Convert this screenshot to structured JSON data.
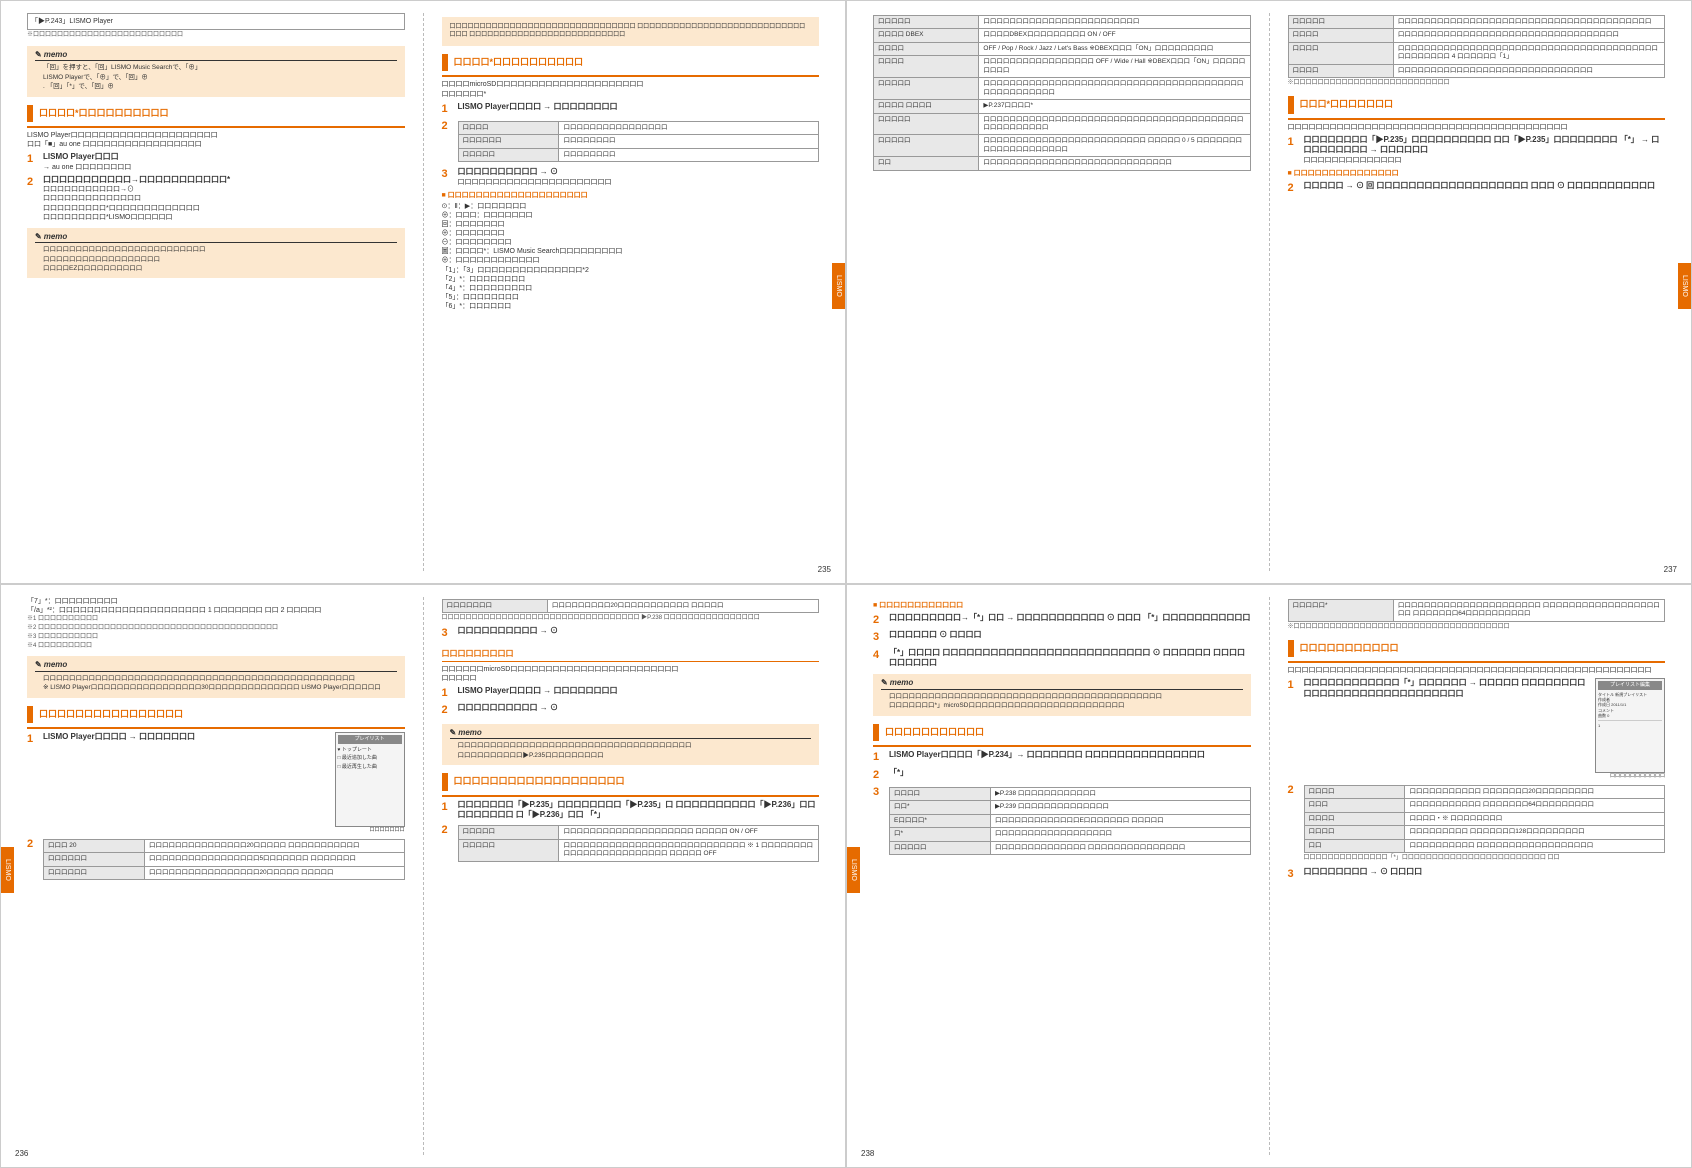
{
  "tab": "LISMO",
  "p235": {
    "num": "235",
    "c1": {
      "top": "「▶P.243」LISMO Player",
      "memo1": [
        "「回」を押すと、「回」LISMO Music Searchで、「⊕」",
        "LISMO Playerで、「⊕」で、「回」⊕",
        ". 「回」「*」で、「回」⊕"
      ],
      "sect1": "口口口口*口口口口口口口口口口",
      "body1": [
        "LISMO Player口口口口口口口口口口口口口口口口口口口口口",
        "口口「■」au one 口口口口口口口口口口口口口口口口口"
      ],
      "step1": {
        "t": "LISMO Player口口口",
        "s": "→ au one 口口口口口口口口"
      },
      "step2": "口口口口口口口口口口口→口口口口口口口口口口口*",
      "step2b": [
        "口口口口口口口口口口口→⊙",
        "口口口口口口口口口口口口口口",
        "口口口口口口口口口*口口口口口口口口口口口口口",
        "口口口口口口口口口*LISMO口口口口口口"
      ],
      "memo2": [
        "口口口口口口口口口口口口口口口口口口口口口口口口口",
        "口口口口口口口口口口口口口口口口口口",
        "口口口口EZ口口口口口口口口口口"
      ]
    },
    "c2": {
      "beige": "口口口口口口口口口口口口口口口口口口口口口口口口口口口口口口口\n口口口口口口口口口口口口口口口口口口口口口口口口口口口口口口口\n口口口口口口口口口口口口口口口口口口口口口口口口口口",
      "sect": "口口口口*口口口口口口口口口口",
      "body": [
        "口口口口microSD口口口口口口口口口口口口口口口口口口口口口",
        "口口口口口口*"
      ],
      "step1": "LISMO Player口口口口 → 口口口口口口口口",
      "step2tbl": [
        [
          "口口口口",
          "口口口口口口口口口口口口口口口口"
        ],
        [
          "口口口口口口",
          "口口口口口口口口"
        ],
        [
          "口口口口口",
          "口口口口口口口口"
        ]
      ],
      "step3": "口口口口口口口口口口 → ⊙",
      "sub": "■ 口口口口口口口口口口口口口口口口口口口口",
      "keys": [
        "⊙：Ⅱ：▶：口口口口口口口",
        "⊕：口口口：口口口口口口口",
        "回：口口口口口口口",
        "⊕：口口口口口口口",
        "⊖：口口口口口口口口",
        "圖：口口口口*：LISMO Music Search口口口口口口口口口",
        "⊕：口口口口口口口口口口口口",
        "「1」：「3」口口口口口口口口口口口口口口口*2",
        "「2」*：口口口口口口口口",
        "「4」*：口口口口口口口口口",
        "「5」：口口口口口口口口",
        "「6」*：口口口口口口"
      ]
    }
  },
  "p237": {
    "num": "237",
    "c1": {
      "tbl": [
        [
          "口口口口口",
          "口口口口口口口口口口口口口口口口口口口口口口口口"
        ],
        [
          "口口口口 DBEX",
          "口口口口DBEX口口口口口口口口口\nON / OFF"
        ],
        [
          "口口口口",
          "OFF / Pop / Rock / Jazz / Let's Bass\n※DBEX口口口「ON」口口口口口口口口口"
        ],
        [
          "口口口口",
          "口口口口口口口口口口口口口口口口口\nOFF / Wide / Hall\n※DBEX口口口「ON」口口口口口口口口口"
        ],
        [
          "口口口口口",
          "口口口口口口口口口口口口口口口口口口口口口口口口口口口口口口口口口口口口口口口口口口口口口口口口口口口"
        ],
        [
          "口口口口 口口口口",
          "▶P.237口口口口*"
        ],
        [
          "口口口口口",
          "口口口口口口口口口口口口口口口口口口口口口口口口口口口口口口口口口口口口口口口口口口口口口口口口口口"
        ],
        [
          "口口口口口",
          "口口口口口口口口口口口口口口口口口口口口口口口口口\n口口口口口 0 / 5 口口口口口口口口口口口口口口口口口口口口"
        ],
        [
          "口口",
          "口口口口口口口口口口口口口口口口口口口口口口口口口口口口口"
        ]
      ]
    },
    "c2": {
      "tbl": [
        [
          "口口口口口",
          "口口口口口口口口口口口口口口口口口口口口口口口口口口口口口口口口口口口口口口口"
        ],
        [
          "口口口口",
          "口口口口口口口口口口口口口口口口口口口口口口口口口口口口口口口口口口"
        ],
        [
          "口口口口",
          "口口口口口口口口口口口口口口口口口口口口口口口口口口口口口口口口口口口口口口口口口口口口口口口口 4 口口口口口口「1」"
        ],
        [
          "口口口口",
          "口口口口口口口口口口口口口口口口口口口口口口口口口口口口口口"
        ]
      ],
      "note": "※口口口口口口口口口口口口口口口口口口口口口口口口口口",
      "sect": "口口口*口口口口口口口",
      "body": "口口口口口口口口口口口口口口口口口口口口口口口口口口口口口口口口口口口口口口口口",
      "step1": "口口口口口口口口「▶P.235」口口口口口口口口口口 \n口口「▶P.235」口口口口口口口口  「*」\n→ 口口口口口口口口口 → 口口口口口口",
      "sub": "■ 口口口口口口口口口口口口口口口",
      "step2": "口口口口口 → ⊙\n回 口口口口口口口口口口口口口口口口口口口\n口口口 ⊙ 口口口口口口口口口口口"
    }
  },
  "p236": {
    "num": "236",
    "c1": {
      "keys": [
        "「7」*：口口口口口口口口口",
        "「/a」*²：口口口口口口口口口口口口口口口口口口口口口 1 口口口口口口口\n 口口 2 口口口口口"
      ],
      "notes": [
        "※1 口口口口口口口口口口",
        "※2 口口口口口口口口口口口口口口口口口口口口口口口口口口口口口口口口口口口口口口口口",
        "※3 口口口口口口口口口口",
        "※4 口口口口口口口口口"
      ],
      "memo": [
        "口口口口口口口口口口口口口口口口口口口口口口口口口口口口口口口口口口口口口口口口口口口口口口口口",
        "※ LISMO Player口口口口口口口口口口口口口口口口口30口口口口口口口口口口口口口口\n LISMO Player口口口口口口"
      ],
      "sect": "口口口口口口口口口口口口口口口口",
      "step1": "LISMO Player口口口口\n→ 口口口口口口口",
      "mock": {
        "title": "プレイリスト",
        "items": [
          "♥ トップレート",
          "□ 最近追加した曲",
          "□ 最近再生した曲"
        ],
        "cap": "口口口口口口口"
      },
      "step2tbl": [
        [
          "口口口 20",
          "口口口口口口口口口口口口口口口20口口口口口\n口口口口口口口口口口口"
        ],
        [
          "口口口口口口",
          "口口口口口口口口口口口口口口口口口5口口口口口口口\n口口口口口口口"
        ],
        [
          "口口口口口口",
          "口口口口口口口口口口口口口口口口口20口口口口口\n口口口口口"
        ]
      ]
    },
    "c2": {
      "tbl1": [
        [
          "口口口口口口口",
          "口口口口口口口口口20口口口口口口口口口口口\n口口口口口"
        ]
      ],
      "tbl1note": "口口口口口口口口口口口口口口口口口口口口口口口口口口口口口口口口口\n▶P.238 口口口口口口口口口口口口口口口口",
      "step3": "口口口口口口口口口口 → ⊙",
      "sect1": "口口口口口口口口口",
      "body1": [
        "口口口口口口microSD口口口口口口口口口口口口口口口口口口口口口口口口",
        "口口口口口"
      ],
      "step1": "LISMO Player口口口口 → 口口口口口口口口",
      "step2": "口口口口口口口口口口 → ⊙",
      "memo": [
        "口口口口口口口口口口口口口口口口口口口口口口口口口口口口口口口口口口口口",
        "口口口口口口口口口口▶P.235口口口口口口口口口"
      ],
      "sect2": "口口口口口口口口口口口口口口口口口口口",
      "step1b": "口口口口口口口「▶P.235」口口口口口口口口「▶P.235」口\n口口口口口口口口口口「▶P.236」口口口口口口口口口\n口「▶P.236」口口  「*」",
      "step2btbl": [
        [
          "口口口口口",
          "口口口口口口口口口口口口口口口口口口口口\n口口口口口\nON / OFF"
        ],
        [
          "口口口口口",
          "口口口口口口口口口口口口口口口口口口口口口口口口口口口口\n※ 1 口口口口口口口口口口口口口口口口口口口口口口口口\n口口口口口 OFF"
        ]
      ]
    }
  },
  "p238": {
    "num": "238",
    "c1": {
      "sub": "■ 口口口口口口口口口口口口",
      "step2": "口口口口口口口口口→「*」口口 → 口口口口口口口口口口口\n⊙ 口口口\n「*」口口口口口口口口口口口",
      "step3": "口口口口口口  ⊙ 口口口口",
      "step4": "「*」口口口口\n口口口口口口口口口口口口口口口口口口口口口口口口口口 ⊙ 口口口口口口\n口口口口口口口口口口",
      "memo": [
        "口口口口口口口口口口口口口口口口口口口口口口口口口口口口口口口口口口口口口口口口口口",
        "口口口口口口口*」microSD口口口口口口口口口口口口口口口口口口口口口口口口"
      ],
      "sect": "口口口口口口口口口口口",
      "step1b": "LISMO Player口口口口「▶P.234」→ 口口口口口口口\n口口口口口口口口口口口口口口口",
      "step2b": "「*」",
      "step3tbl": [
        [
          "口口口口",
          "▶P.238 口口口口口口口口口口口口"
        ],
        [
          "口口*",
          "▶P.239 口口口口口口口口口口口口口口"
        ],
        [
          "E口口口口*",
          "口口口口口口口口口口口口口E口口口口口口口\n口口口口口"
        ],
        [
          "口*",
          "口口口口口口口口口口口口口口口口口口"
        ],
        [
          "口口口口口",
          "口口口口口口口口口口口口口口\n口口口口口口口口口口口口口口口"
        ]
      ]
    },
    "c2": {
      "tbl1": [
        [
          "口口口口口*",
          "口口口口口口口口口口口口口口口口口口口口口口\n口口口口口口口口口口口口口口口口口口口口\n口口口口口口口64口口口口口口口口口口"
        ]
      ],
      "note": "※口口口口口口口口口口口口口口口口口口口口口口口口口口口口口口口口口口口口",
      "sect": "口口口口口口口口口口口",
      "body": "口口口口口口口口口口口口口口口口口口口口口口口口口口口口口口口口口口口口口口口口口口口口口口口口口口口口",
      "step1": "口口口口口口口口口口口口「*」口口口口口口\n→ 口口口口口\n口口口口口口口口口口口口口口口口口口口口口口口口口口口口",
      "mock": {
        "title": "プレイリスト編集",
        "rows": [
          "タイトル  新規プレイリスト",
          "作成者",
          "作成日  2011/1/1",
          "コメント",
          "曲数  0"
        ],
        "extra": "1",
        "cap": "口口口口口口口口口口口"
      },
      "step2tbl": [
        [
          "口口口口",
          "口口口口口口口口口口口\n口口口口口口口20口口口口口口口口口"
        ],
        [
          "口口口",
          "口口口口口口口口口口口\n口口口口口口口64口口口口口口口口口"
        ],
        [
          "口口口口",
          "口口口口・※ 口口口口口口口口"
        ],
        [
          "口口口口",
          "口口口口口口口口口\n口口口口口口口128口口口口口口口口口"
        ],
        [
          "口口",
          "口口口口口口口口口口\n口口口口口口口口口口口口口口口口口口"
        ]
      ],
      "tbl2note": "口口口口口口口口口口口口口口「*」口口口口口口口口口口口口口口口口口口口口口口口口\n口口",
      "step3": "口口口口口口口口 → ⊙ 口口口口"
    }
  }
}
